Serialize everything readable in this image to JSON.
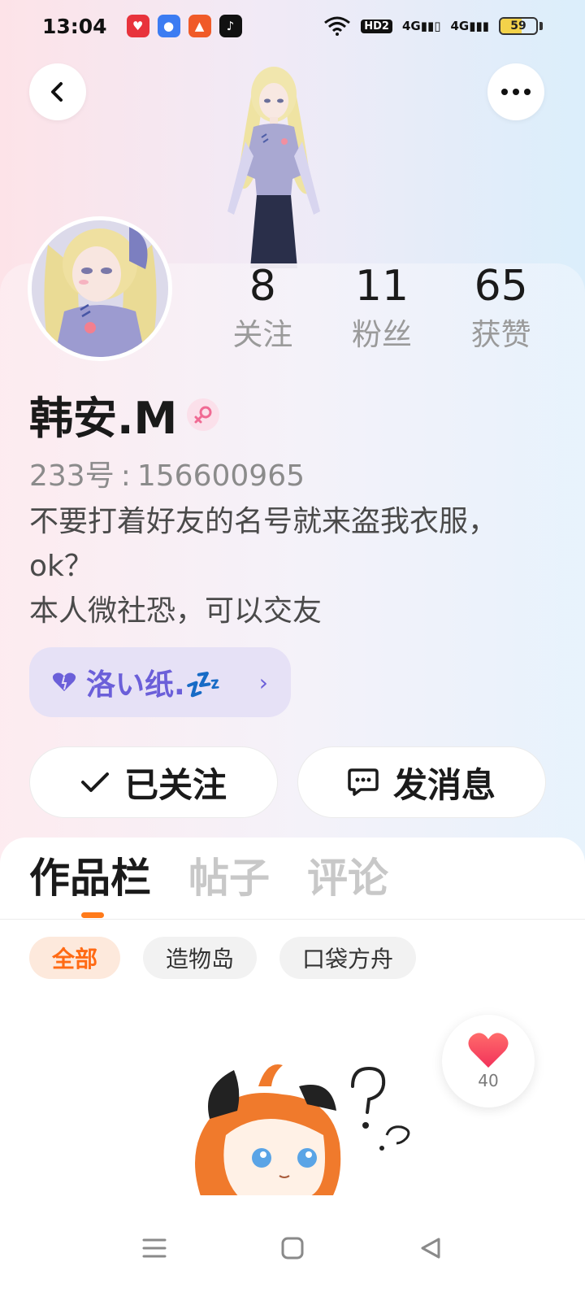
{
  "status_bar": {
    "time": "13:04",
    "notification_icons": [
      "heart-shield-app-icon",
      "messenger-app-icon",
      "cake-app-icon",
      "tiktok-app-icon"
    ],
    "hd_label": "HD2",
    "signal_1_label": "4G",
    "signal_2_label": "4G",
    "battery_level": "59",
    "battery_fraction": 0.59,
    "battery_color": "#f3d24a"
  },
  "header": {
    "back_icon": "chevron-left-icon",
    "more_icon": "more-horizontal-icon"
  },
  "profile": {
    "stats": [
      {
        "value": "8",
        "label": "关注"
      },
      {
        "value": "11",
        "label": "粉丝"
      },
      {
        "value": "65",
        "label": "获赞"
      }
    ],
    "name": "韩安.M",
    "gender_icon": "female-icon",
    "uid_label": "233号",
    "uid_separator": ":",
    "uid_value": "156600965",
    "bio_lines": [
      "不要打着好友的名号就来盗我衣服，ok？",
      "本人微社恐，可以交友"
    ],
    "badge": {
      "icon": "heart-icon",
      "text": "洛い纸.💤",
      "chevron": "›",
      "accent": "#6b5fd9"
    },
    "follow_button": {
      "icon": "check-icon",
      "label": "已关注"
    },
    "message_button": {
      "icon": "chat-bubble-icon",
      "label": "发消息"
    }
  },
  "content": {
    "tabs": [
      {
        "label": "作品栏",
        "active": true
      },
      {
        "label": "帖子",
        "active": false
      },
      {
        "label": "评论",
        "active": false
      }
    ],
    "accent": "#ff7a1a",
    "filter_chips": [
      {
        "label": "全部",
        "active": true
      },
      {
        "label": "造物岛",
        "active": false
      },
      {
        "label": "口袋方舟",
        "active": false
      }
    ],
    "like_button": {
      "icon": "heart-icon",
      "count": "40"
    }
  },
  "nav_bar": {
    "items": [
      "menu-icon",
      "home-square-icon",
      "back-triangle-icon"
    ]
  }
}
